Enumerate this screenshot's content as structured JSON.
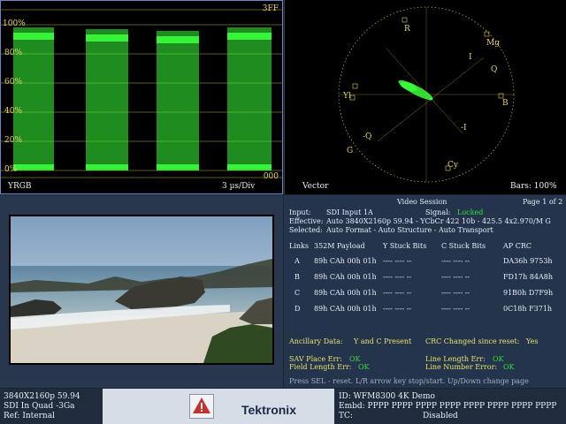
{
  "colors": {
    "trace": "#39ff3a",
    "graticule": "#e6d36a",
    "panel": "#24344c",
    "ok": "#35e035",
    "label": "#e8e26a"
  },
  "waveform": {
    "scale_labels": [
      "100%",
      "80%",
      "60%",
      "40%",
      "20%",
      "0%"
    ],
    "top_right": "3FF",
    "bottom_right": "000",
    "mode": "YRGB",
    "timebase": "3 µs/Div"
  },
  "vector": {
    "title": "Vector",
    "bars": "Bars: 100%",
    "targets": [
      "R",
      "Mg",
      "B",
      "Cy",
      "G",
      "Yl"
    ],
    "axes": [
      "Q",
      "I",
      "-Q",
      "-I"
    ]
  },
  "session": {
    "title": "Video Session",
    "page": "Page 1 of 2",
    "input_label": "Input:",
    "input_value": "SDI Input 1A",
    "signal_label": "Signal:",
    "signal_value": "Locked",
    "effective_label": "Effective:",
    "effective_value": "Auto 3840X2160p 59.94 - YCbCr 422 10b - 425.5 4x2.970/M G",
    "selected_label": "Selected:",
    "selected_value": "Auto Format - Auto Structure - Auto Transport",
    "columns": [
      "Links",
      "352M Payload",
      "Y Stuck Bits",
      "C Stuck Bits",
      "AP CRC"
    ],
    "rows": [
      {
        "link": "A",
        "payload": "89h CAh 00h 01h",
        "y": "---- ---- --",
        "c": "---- ---- --",
        "crc": "DA36h  9753h"
      },
      {
        "link": "B",
        "payload": "89h CAh 00h 01h",
        "y": "---- ---- --",
        "c": "---- ---- --",
        "crc": "FD17h  84A8h"
      },
      {
        "link": "C",
        "payload": "89h CAh 00h 01h",
        "y": "---- ---- --",
        "c": "---- ---- --",
        "crc": "91B0h  D7F9h"
      },
      {
        "link": "D",
        "payload": "89h CAh 00h 01h",
        "y": "---- ---- --",
        "c": "---- ---- --",
        "crc": "0C18h  F371h"
      }
    ],
    "ancillary_label": "Ancillary Data:",
    "ancillary_value": "Y and C Present",
    "crc_changed_label": "CRC Changed since reset:",
    "crc_changed_value": "Yes",
    "sav_label": "SAV Place Err:",
    "sav_value": "OK",
    "line_length_label": "Line Length Err:",
    "line_length_value": "OK",
    "field_length_label": "Field Length Err:",
    "field_length_value": "OK",
    "line_number_label": "Line Number Error:",
    "line_number_value": "OK",
    "hint": "Press SEL - reset. L/R arrow key stop/start. Up/Down change page"
  },
  "status": {
    "format": "3840X2160p 59.94",
    "sdi": "SDI In Quad -3Ga",
    "ref": "Ref: Internal",
    "brand": "Tektronix",
    "id": "ID: WFM8300 4K Demo",
    "embd": "Embd: PPPP PPPP PPPP PPPP PPPP PPPP PPPP PPPP",
    "tc_label": "TC:",
    "tc_value": "Disabled"
  }
}
